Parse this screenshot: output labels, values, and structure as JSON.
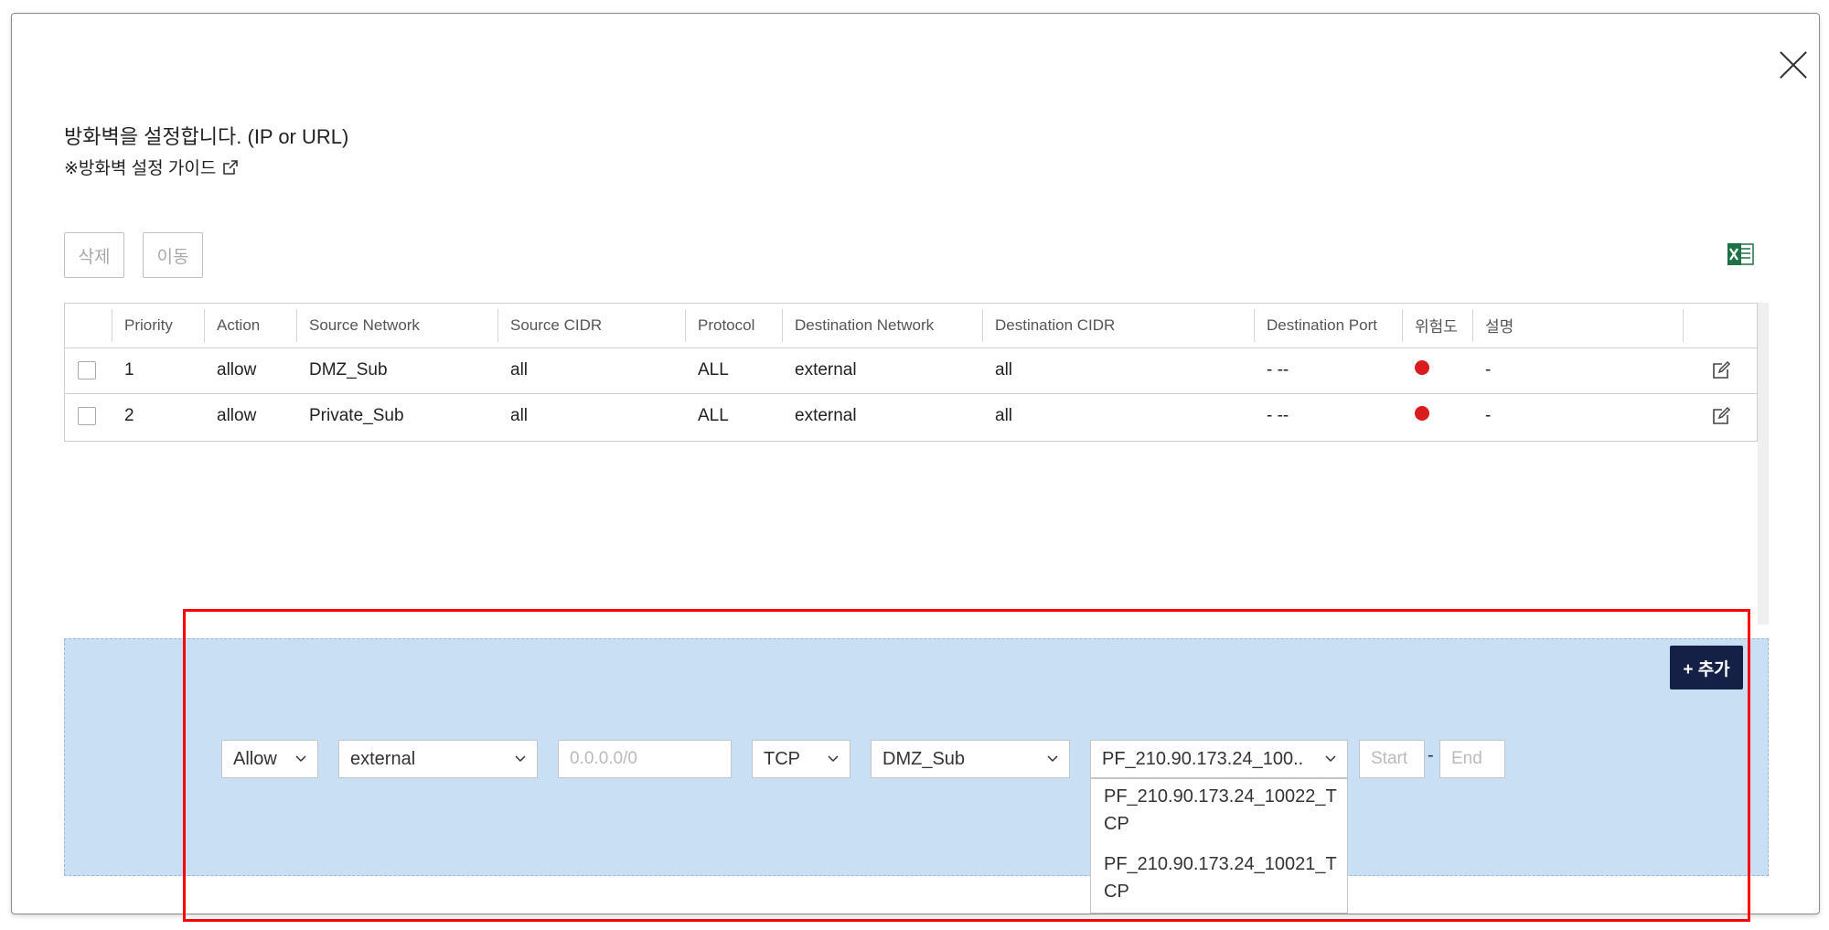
{
  "modal": {
    "description": "방화벽을 설정합니다. (IP or URL)",
    "guide_link": "※방화벽 설정 가이드"
  },
  "toolbar": {
    "delete_label": "삭제",
    "move_label": "이동",
    "excel_icon": "excel-icon"
  },
  "table": {
    "headers": [
      "",
      "Priority",
      "Action",
      "Source Network",
      "Source CIDR",
      "Protocol",
      "Destination Network",
      "Destination CIDR",
      "Destination Port",
      "위험도",
      "설명",
      ""
    ],
    "rows": [
      {
        "priority": "1",
        "action": "allow",
        "source_network": "DMZ_Sub",
        "source_cidr": "all",
        "protocol": "ALL",
        "destination_network": "external",
        "destination_cidr": "all",
        "destination_port": "- --",
        "risk_color": "#d91c1c",
        "description": "-"
      },
      {
        "priority": "2",
        "action": "allow",
        "source_network": "Private_Sub",
        "source_cidr": "all",
        "protocol": "ALL",
        "destination_network": "external",
        "destination_cidr": "all",
        "destination_port": "- --",
        "risk_color": "#d91c1c",
        "description": "-"
      }
    ]
  },
  "add_form": {
    "add_button": "+ 추가",
    "action_value": "Allow",
    "source_network_value": "external",
    "source_cidr_placeholder": "0.0.0.0/0",
    "protocol_value": "TCP",
    "destination_network_value": "DMZ_Sub",
    "destination_cidr_value": "PF_210.90.173.24_100..",
    "port_start_placeholder": "Start",
    "port_separator": "-",
    "port_end_placeholder": "End",
    "dropdown_options": [
      "PF_210.90.173.24_10022_TCP",
      "PF_210.90.173.24_10021_TCP"
    ]
  },
  "colors": {
    "add_area_bg": "#c8dff4",
    "add_button_bg": "#142046",
    "highlight_border": "#ff0000",
    "risk_high": "#d91c1c"
  }
}
